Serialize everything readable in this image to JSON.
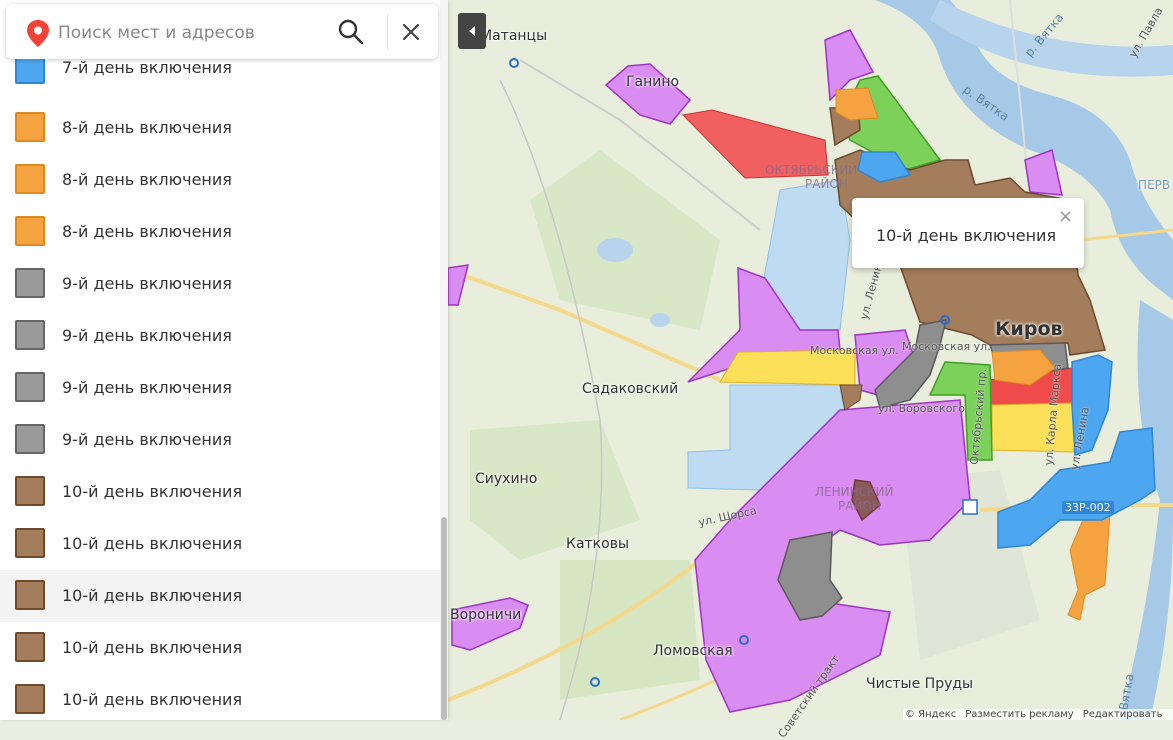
{
  "search": {
    "placeholder": "Поиск мест и адресов"
  },
  "legend": {
    "colors": {
      "day7": "#4da6f0",
      "day8": "#f5a340",
      "day9": "#9a9a9a",
      "day10": "#a47e5c",
      "border_day7": "#2f86d6",
      "border_day8": "#e08a1e",
      "border_day9": "#666666",
      "border_day10": "#6d4a2c"
    },
    "items": [
      {
        "label": "7-й день включения"
      },
      {
        "label": "8-й день включения"
      },
      {
        "label": "8-й день включения"
      },
      {
        "label": "8-й день включения"
      },
      {
        "label": "9-й день включения"
      },
      {
        "label": "9-й день включения"
      },
      {
        "label": "9-й день включения"
      },
      {
        "label": "9-й день включения"
      },
      {
        "label": "10-й день включения"
      },
      {
        "label": "10-й день включения"
      },
      {
        "label": "10-й день включения"
      },
      {
        "label": "10-й день включения"
      },
      {
        "label": "10-й день включения"
      }
    ]
  },
  "balloon": {
    "text": "10-й день включения",
    "close": "×"
  },
  "map": {
    "places": {
      "matantsy": "Матанцы",
      "ganino": "Ганино",
      "sadakovsky": "Садаковский",
      "siukhino": "Сиухино",
      "katkovy": "Катковы",
      "voronichi": "Вороничи",
      "lomovskaya": "Ломовская",
      "chistye_prudy": "Чистые Пруды",
      "kirov": "Киров",
      "perv": "ПЕРВ",
      "oktyabrsky": "ОКТЯБРЬСКИЙ",
      "oktyabrsky2": "РАЙОН",
      "leninsky": "ЛЕНИНСКИЙ",
      "leninsky2": "РАЙОН"
    },
    "streets": {
      "ul_pavla": "ул. Павла",
      "r_vyatka1": "р. Вятка",
      "r_vyatka2": "р. Вятка",
      "r_vyatka3": "Вятка",
      "ul_lenina": "ул. Ленина",
      "moskovskaya1": "Московская ул.",
      "moskovskaya2": "Московская ул.",
      "vorovskogo": "ул. Воровского",
      "shchorsa": "ул. Щорса",
      "oktyabrsky_pr": "Октябрьский пр.",
      "karla_marksa": "ул. Карла Маркса",
      "lenina2": "ул. Ленина",
      "sovetsky_trakt": "Советский тракт",
      "road_33r": "33Р-002"
    },
    "footer": {
      "copyright": "© Яндекс",
      "ads": "Разместить рекламу",
      "edit": "Редактировать"
    }
  }
}
